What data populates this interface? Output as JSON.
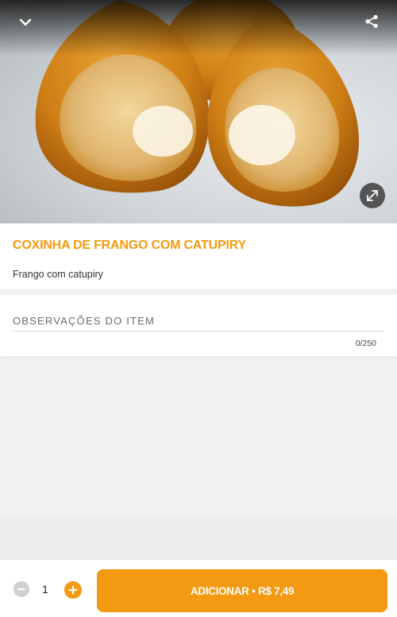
{
  "hero": {
    "image_alt": "Coxinha de frango com catupiry",
    "back_icon": "chevron-down-icon",
    "share_icon": "share-icon",
    "expand_icon": "expand-icon"
  },
  "product": {
    "title": "COXINHA DE FRANGO COM CATUPIRY",
    "description": "Frango com catupiry"
  },
  "notes": {
    "label": "OBSERVAÇÕES DO ITEM",
    "counter": "0/250"
  },
  "footer": {
    "quantity": "1",
    "add_label": "ADICIONAR",
    "separator": "•",
    "price": "R$ 7,49"
  },
  "colors": {
    "accent": "#f39a12",
    "minus_disabled": "#cfcfcf"
  }
}
